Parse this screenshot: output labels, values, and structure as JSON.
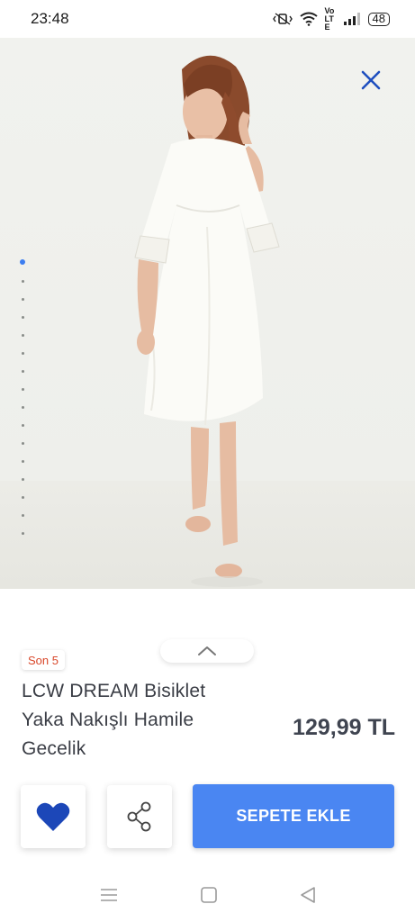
{
  "status_bar": {
    "time": "23:48",
    "network": "VoLTE",
    "battery": "48"
  },
  "product_image": {
    "current_index": 1,
    "dot_count": 16
  },
  "icons": {
    "close": "close-icon",
    "expand": "chevron-up-icon",
    "favorite": "heart-icon",
    "share": "share-icon"
  },
  "product": {
    "stock_badge": "Son 5",
    "title_lines": [
      "LCW DREAM Bisiklet",
      "Yaka Nakışlı Hamile",
      "Gecelik"
    ],
    "price": "129,99 TL"
  },
  "actions": {
    "add_to_cart": "SEPETE EKLE"
  },
  "colors": {
    "accent": "#4a86f2",
    "heart": "#1c47b8",
    "badge_text": "#d9482b",
    "close_icon": "#1e4fbf"
  }
}
